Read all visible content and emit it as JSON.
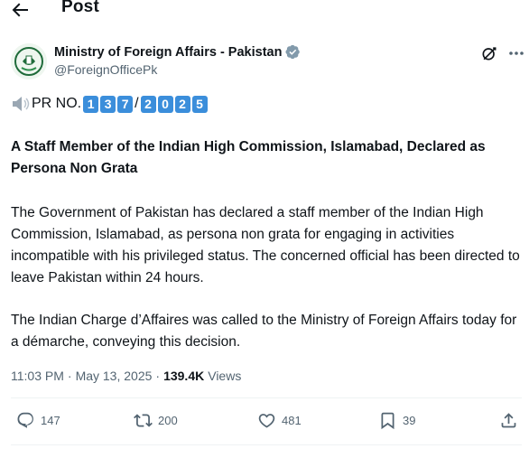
{
  "header": {
    "title": "Post"
  },
  "author": {
    "display_name": "Ministry of Foreign Affairs - Pakistan",
    "handle": "@ForeignOfficePk"
  },
  "post": {
    "pr_label": "PR NO.",
    "pr_digits_a": [
      "1",
      "3",
      "7"
    ],
    "pr_slash": "/",
    "pr_digits_b": [
      "2",
      "0",
      "2",
      "5"
    ],
    "headline": "A Staff Member of the Indian High Commission, Islamabad, Declared as Persona Non Grata",
    "paragraph_1": "The Government of Pakistan has declared a staff member of the Indian High Commission, Islamabad, as persona non grata for engaging in activities incompatible with his privileged status. The concerned official has been directed to leave Pakistan within 24 hours.",
    "paragraph_2": "The Indian Charge d’Affaires was called to the Ministry of Foreign Affairs today for a démarche, conveying this decision."
  },
  "meta": {
    "time": "11:03 PM",
    "date": "May 13, 2025",
    "separator": "·",
    "views_count": "139.4K",
    "views_label": "Views"
  },
  "actions": {
    "replies": "147",
    "reposts": "200",
    "likes": "481",
    "bookmarks": "39"
  },
  "colors": {
    "accent": "#1d9bf0",
    "text": "#0f1419",
    "muted": "#536471",
    "pr_digit_bg": "#3b8edb"
  }
}
